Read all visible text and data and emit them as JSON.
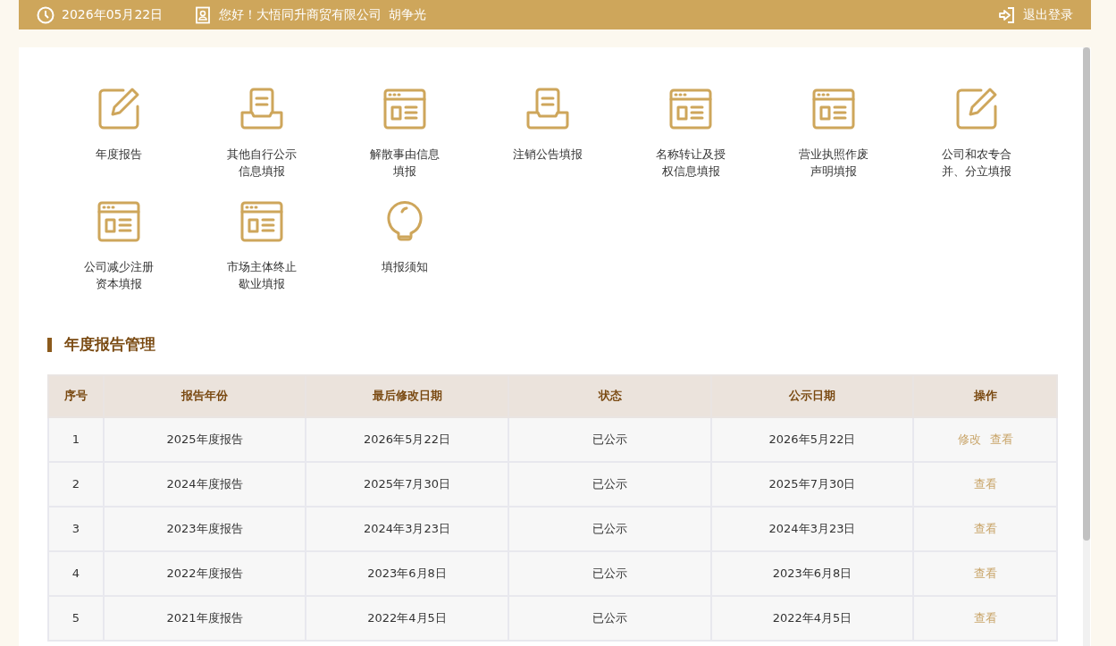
{
  "header": {
    "date": "2026年05月22日",
    "greeting": "您好！大悟同升商贸有限公司",
    "user": "胡争光",
    "logout": "退出登录"
  },
  "tiles": [
    {
      "label": "年度报告",
      "kind": "edit"
    },
    {
      "label": "其他自行公示信息填报",
      "kind": "tray"
    },
    {
      "label": "解散事由信息填报",
      "kind": "window"
    },
    {
      "label": "注销公告填报",
      "kind": "tray"
    },
    {
      "label": "名称转让及授权信息填报",
      "kind": "window"
    },
    {
      "label": "营业执照作废声明填报",
      "kind": "window"
    },
    {
      "label": "公司和农专合并、分立填报",
      "kind": "edit"
    },
    {
      "label": "公司减少注册资本填报",
      "kind": "window"
    },
    {
      "label": "市场主体终止歇业填报",
      "kind": "window"
    },
    {
      "label": "填报须知",
      "kind": "bulb"
    }
  ],
  "section": {
    "title": "年度报告管理"
  },
  "table": {
    "columns": [
      "序号",
      "报告年份",
      "最后修改日期",
      "状态",
      "公示日期",
      "操作"
    ],
    "rows": [
      {
        "cells": [
          "1",
          "2025年度报告",
          "2026年5月22日",
          "已公示",
          "2026年5月22日"
        ],
        "actions": [
          "修改",
          "查看"
        ]
      },
      {
        "cells": [
          "2",
          "2024年度报告",
          "2025年7月30日",
          "已公示",
          "2025年7月30日"
        ],
        "actions": [
          "查看"
        ]
      },
      {
        "cells": [
          "3",
          "2023年度报告",
          "2024年3月23日",
          "已公示",
          "2024年3月23日"
        ],
        "actions": [
          "查看"
        ]
      },
      {
        "cells": [
          "4",
          "2022年度报告",
          "2023年6月8日",
          "已公示",
          "2023年6月8日"
        ],
        "actions": [
          "查看"
        ]
      },
      {
        "cells": [
          "5",
          "2021年度报告",
          "2022年4月5日",
          "已公示",
          "2022年4月5日"
        ],
        "actions": [
          "查看"
        ]
      }
    ]
  }
}
